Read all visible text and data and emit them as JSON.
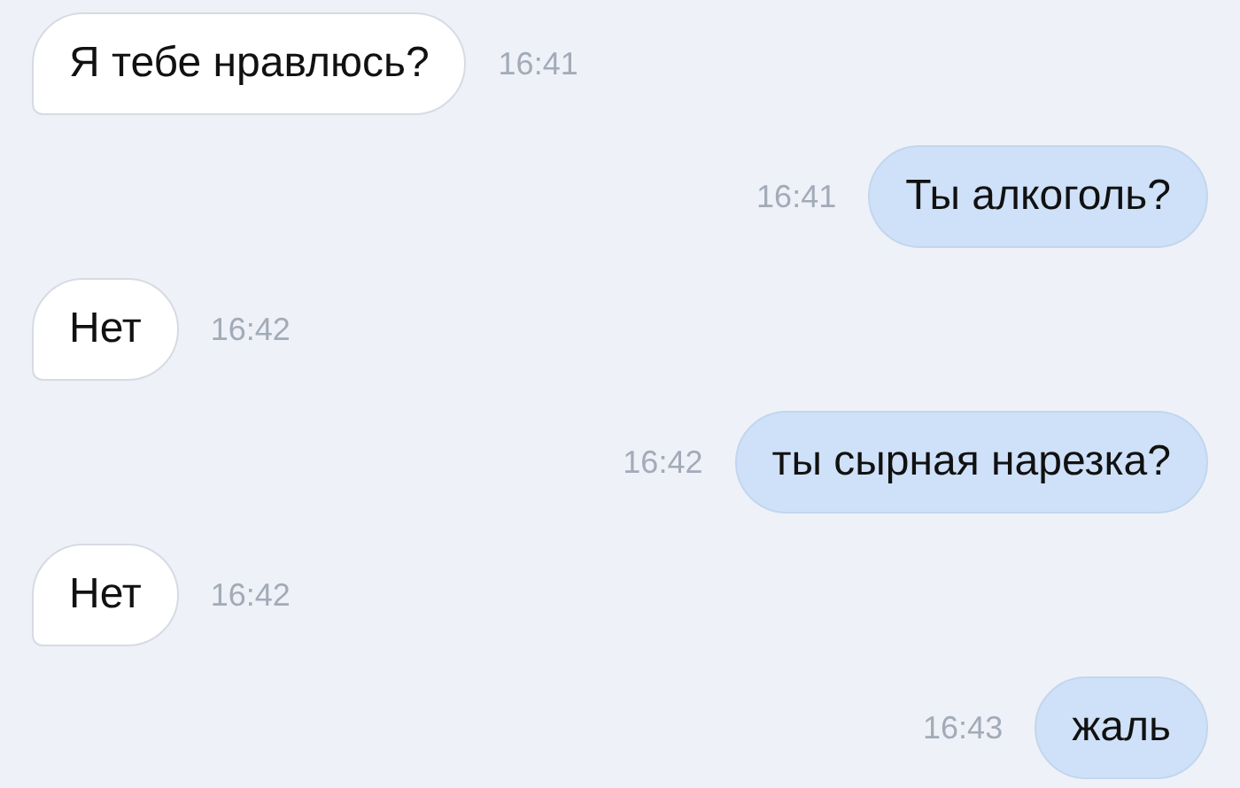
{
  "messages": [
    {
      "kind": "incoming",
      "text": "Я тебе нравлюсь?",
      "time": "16:41"
    },
    {
      "kind": "outgoing",
      "text": "Ты алкоголь?",
      "time": "16:41"
    },
    {
      "kind": "incoming",
      "text": "Нет",
      "time": "16:42"
    },
    {
      "kind": "outgoing",
      "text": "ты сырная нарезка?",
      "time": "16:42"
    },
    {
      "kind": "incoming",
      "text": "Нет",
      "time": "16:42"
    },
    {
      "kind": "outgoing",
      "text": "жаль",
      "time": "16:43"
    }
  ]
}
